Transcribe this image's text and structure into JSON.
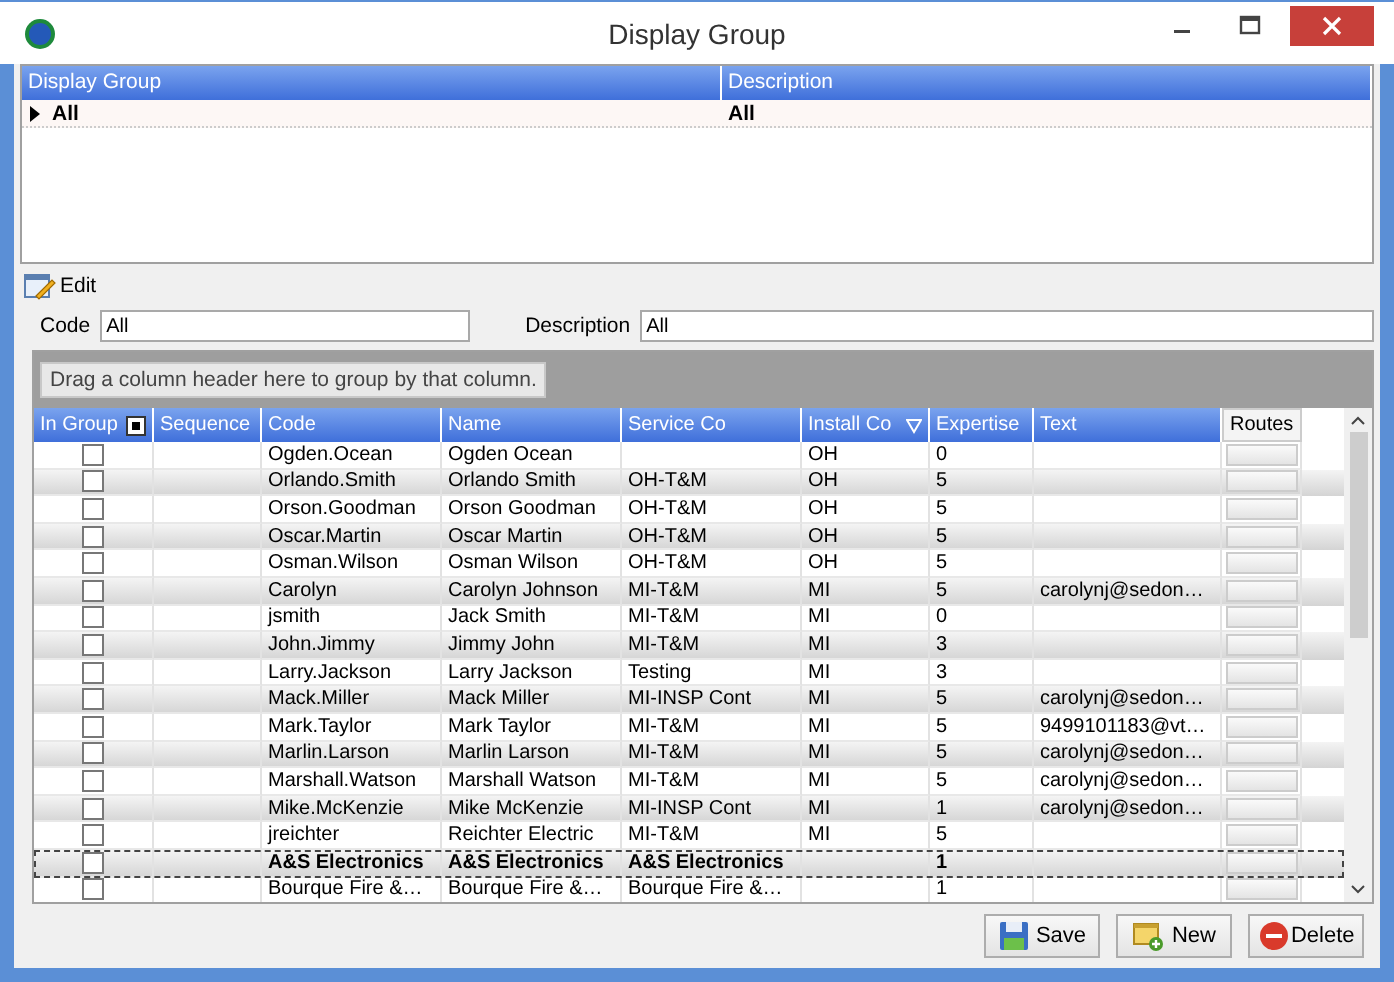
{
  "window": {
    "title": "Display Group"
  },
  "display_groups": {
    "columns": [
      "Display Group",
      "Description"
    ],
    "rows": [
      {
        "display_group": "All",
        "description": "All",
        "selected": true
      }
    ]
  },
  "edit": {
    "label": "Edit",
    "code_label": "Code",
    "code_value": "All",
    "description_label": "Description",
    "description_value": "All"
  },
  "members": {
    "group_panel": "Drag a column header here to group by that column.",
    "columns": [
      {
        "label": "In Group",
        "kind": "check"
      },
      {
        "label": "Sequence",
        "kind": "text"
      },
      {
        "label": "Code",
        "kind": "text"
      },
      {
        "label": "Name",
        "kind": "text"
      },
      {
        "label": "Service Co",
        "kind": "text"
      },
      {
        "label": "Install Co",
        "kind": "filter"
      },
      {
        "label": "Expertise",
        "kind": "text"
      },
      {
        "label": "Text",
        "kind": "text"
      },
      {
        "label": "Routes",
        "kind": "button"
      }
    ],
    "rows": [
      {
        "in_group": false,
        "code": "Ogden.Ocean",
        "name": "Ogden Ocean",
        "service_co": "",
        "install_co": "OH",
        "expertise": "0",
        "text": "",
        "bold": false,
        "selected": false
      },
      {
        "in_group": false,
        "code": "Orlando.Smith",
        "name": "Orlando Smith",
        "service_co": "OH-T&M",
        "install_co": "OH",
        "expertise": "5",
        "text": "",
        "bold": false,
        "selected": false
      },
      {
        "in_group": false,
        "code": "Orson.Goodman",
        "name": "Orson Goodman",
        "service_co": "OH-T&M",
        "install_co": "OH",
        "expertise": "5",
        "text": "",
        "bold": false,
        "selected": false
      },
      {
        "in_group": false,
        "code": "Oscar.Martin",
        "name": "Oscar Martin",
        "service_co": "OH-T&M",
        "install_co": "OH",
        "expertise": "5",
        "text": "",
        "bold": false,
        "selected": false
      },
      {
        "in_group": false,
        "code": "Osman.Wilson",
        "name": "Osman Wilson",
        "service_co": "OH-T&M",
        "install_co": "OH",
        "expertise": "5",
        "text": "",
        "bold": false,
        "selected": false
      },
      {
        "in_group": false,
        "code": "Carolyn",
        "name": "Carolyn Johnson",
        "service_co": "MI-T&M",
        "install_co": "MI",
        "expertise": "5",
        "text": "carolynj@sedon…",
        "bold": false,
        "selected": false
      },
      {
        "in_group": false,
        "code": "jsmith",
        "name": "Jack Smith",
        "service_co": "MI-T&M",
        "install_co": "MI",
        "expertise": "0",
        "text": "",
        "bold": false,
        "selected": false
      },
      {
        "in_group": false,
        "code": "John.Jimmy",
        "name": "Jimmy John",
        "service_co": "MI-T&M",
        "install_co": "MI",
        "expertise": "3",
        "text": "",
        "bold": false,
        "selected": false
      },
      {
        "in_group": false,
        "code": "Larry.Jackson",
        "name": "Larry Jackson",
        "service_co": "Testing",
        "install_co": "MI",
        "expertise": "3",
        "text": "",
        "bold": false,
        "selected": false
      },
      {
        "in_group": false,
        "code": "Mack.Miller",
        "name": "Mack Miller",
        "service_co": "MI-INSP Cont",
        "install_co": "MI",
        "expertise": "5",
        "text": "carolynj@sedon…",
        "bold": false,
        "selected": false
      },
      {
        "in_group": false,
        "code": "Mark.Taylor",
        "name": "Mark Taylor",
        "service_co": "MI-T&M",
        "install_co": "MI",
        "expertise": "5",
        "text": "9499101183@vt…",
        "bold": false,
        "selected": false
      },
      {
        "in_group": false,
        "code": "Marlin.Larson",
        "name": "Marlin Larson",
        "service_co": "MI-T&M",
        "install_co": "MI",
        "expertise": "5",
        "text": "carolynj@sedon…",
        "bold": false,
        "selected": false
      },
      {
        "in_group": false,
        "code": "Marshall.Watson",
        "name": "Marshall Watson",
        "service_co": "MI-T&M",
        "install_co": "MI",
        "expertise": "5",
        "text": "carolynj@sedon…",
        "bold": false,
        "selected": false
      },
      {
        "in_group": false,
        "code": "Mike.McKenzie",
        "name": "Mike McKenzie",
        "service_co": "MI-INSP Cont",
        "install_co": "MI",
        "expertise": "1",
        "text": "carolynj@sedon…",
        "bold": false,
        "selected": false
      },
      {
        "in_group": false,
        "code": "jreichter",
        "name": "Reichter Electric",
        "service_co": "MI-T&M",
        "install_co": "MI",
        "expertise": "5",
        "text": "",
        "bold": false,
        "selected": false
      },
      {
        "in_group": false,
        "code": "A&S Electronics",
        "name": "A&S Electronics",
        "service_co": "A&S Electronics",
        "install_co": "",
        "expertise": "1",
        "text": "",
        "bold": true,
        "selected": true
      },
      {
        "in_group": false,
        "code": "Bourque Fire &…",
        "name": "Bourque Fire &…",
        "service_co": "Bourque Fire &…",
        "install_co": "",
        "expertise": "1",
        "text": "",
        "bold": false,
        "selected": false
      }
    ]
  },
  "buttons": [
    {
      "label": "Save",
      "kind": "save"
    },
    {
      "label": "New",
      "kind": "new"
    },
    {
      "label": "Delete",
      "kind": "delete"
    }
  ]
}
